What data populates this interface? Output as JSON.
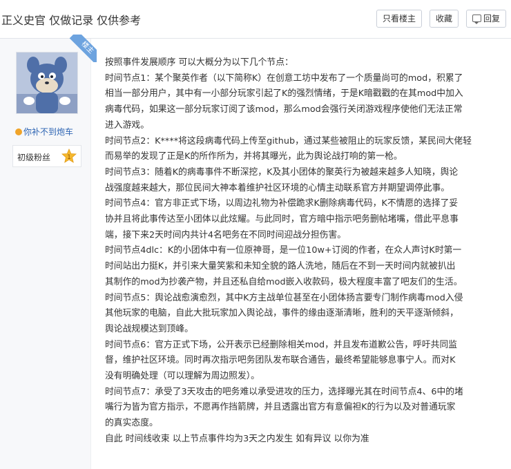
{
  "thread": {
    "title": "正义史官 仅做记录 仅供参考"
  },
  "toolbar": {
    "only_op_label": "只看楼主",
    "favorite_label": "收藏",
    "reply_label": "回复"
  },
  "author": {
    "username": "你补不到炮车",
    "level_title": "初级粉丝",
    "level_number": "1",
    "op_badge": "楼主"
  },
  "post": {
    "lines": [
      "按照事件发展顺序 可以大概分为以下几个节点：",
      "时间节点1：某个聚英作者（以下简称K）在创意工坊中发布了一个质量尚可的mod，积累了",
      "相当一部分用户，其中有一小部分玩家引起了K的强烈情绪，于是K暗戳戳的在其mod中加入",
      "病毒代码，如果这一部分玩家订阅了该mod，那么mod会强行关闭游戏程序使他们无法正常",
      "进入游戏。",
      "时间节点2：K****将这段病毒代码上传至github，通过某些被阻止的玩家反馈，某民间大佬轻",
      "而易举的发现了正是K的所作所为，并将其曝光，此为舆论战打响的第一枪。",
      "时间节点3：随着K的病毒事件不断深挖，K及其小团体的聚英行为被越来越多人知晓，舆论",
      "战强度越来越大，那位民间大神本着维护社区环境的心情主动联系官方并期望调停此事。",
      "时间节点4：官方非正式下场，以周边礼物为补偿跪求K删除病毒代码，K不情愿的选择了妥",
      "协并且将此事传达至小团体以此炫耀。与此同时，官方暗中指示吧务删帖堵嘴，借此平息事",
      "端，接下来2天时间内共计4名吧务在不同时间迎战分担伤害。",
      "时间节点4dlc：K的小团体中有一位原神哥，是一位10w+订阅的作者，在众人声讨K时第一",
      "时间站出力挺K，并引来大量笑紫和未知全貌的路人洗地，随后在不到一天时间内就被扒出",
      "其制作的mod为抄袭产物，并且还私自给mod嵌入收款码，极大程度丰富了吧友们的生活。",
      "时间节点5：舆论战愈演愈烈，其中K方主战单位甚至在小团体扬言要专门制作病毒mod入侵",
      "其他玩家的电脑，自此大批玩家加入舆论战，事件的缘由逐渐清晰，胜利的天平逐渐倾斜，",
      "舆论战规模达到顶峰。",
      "时间节点6：官方正式下场，公开表示已经删除相关mod，并且发布道歉公告，呼吁共同监",
      "督，维护社区环境。同时再次指示吧务团队发布联合通告，最终希望能够息事宁人。而对K",
      "没有明确处理（可以理解为周边照发）。",
      "时间节点7：承受了3天攻击的吧务难以承受进攻的压力，选择曝光其在时间节点4、6中的堵",
      "嘴行为皆为官方指示，不愿再作挡箭牌，并且透露出官方有意偏袒K的行为以及对普通玩家",
      "的真实态度。",
      "自此 时间线收束 以上节点事件均为3天之内发生 如有异议 以你为准"
    ]
  },
  "colors": {
    "username": "#2d64b3",
    "op_badge_bg": "#6da3df",
    "level_badge": "#f5b82e",
    "sidebar_bg": "#f7f8fa"
  },
  "icons": {
    "reply": "reply-icon",
    "level_badge": "level-badge-icon",
    "user_icon": "user-icon"
  }
}
